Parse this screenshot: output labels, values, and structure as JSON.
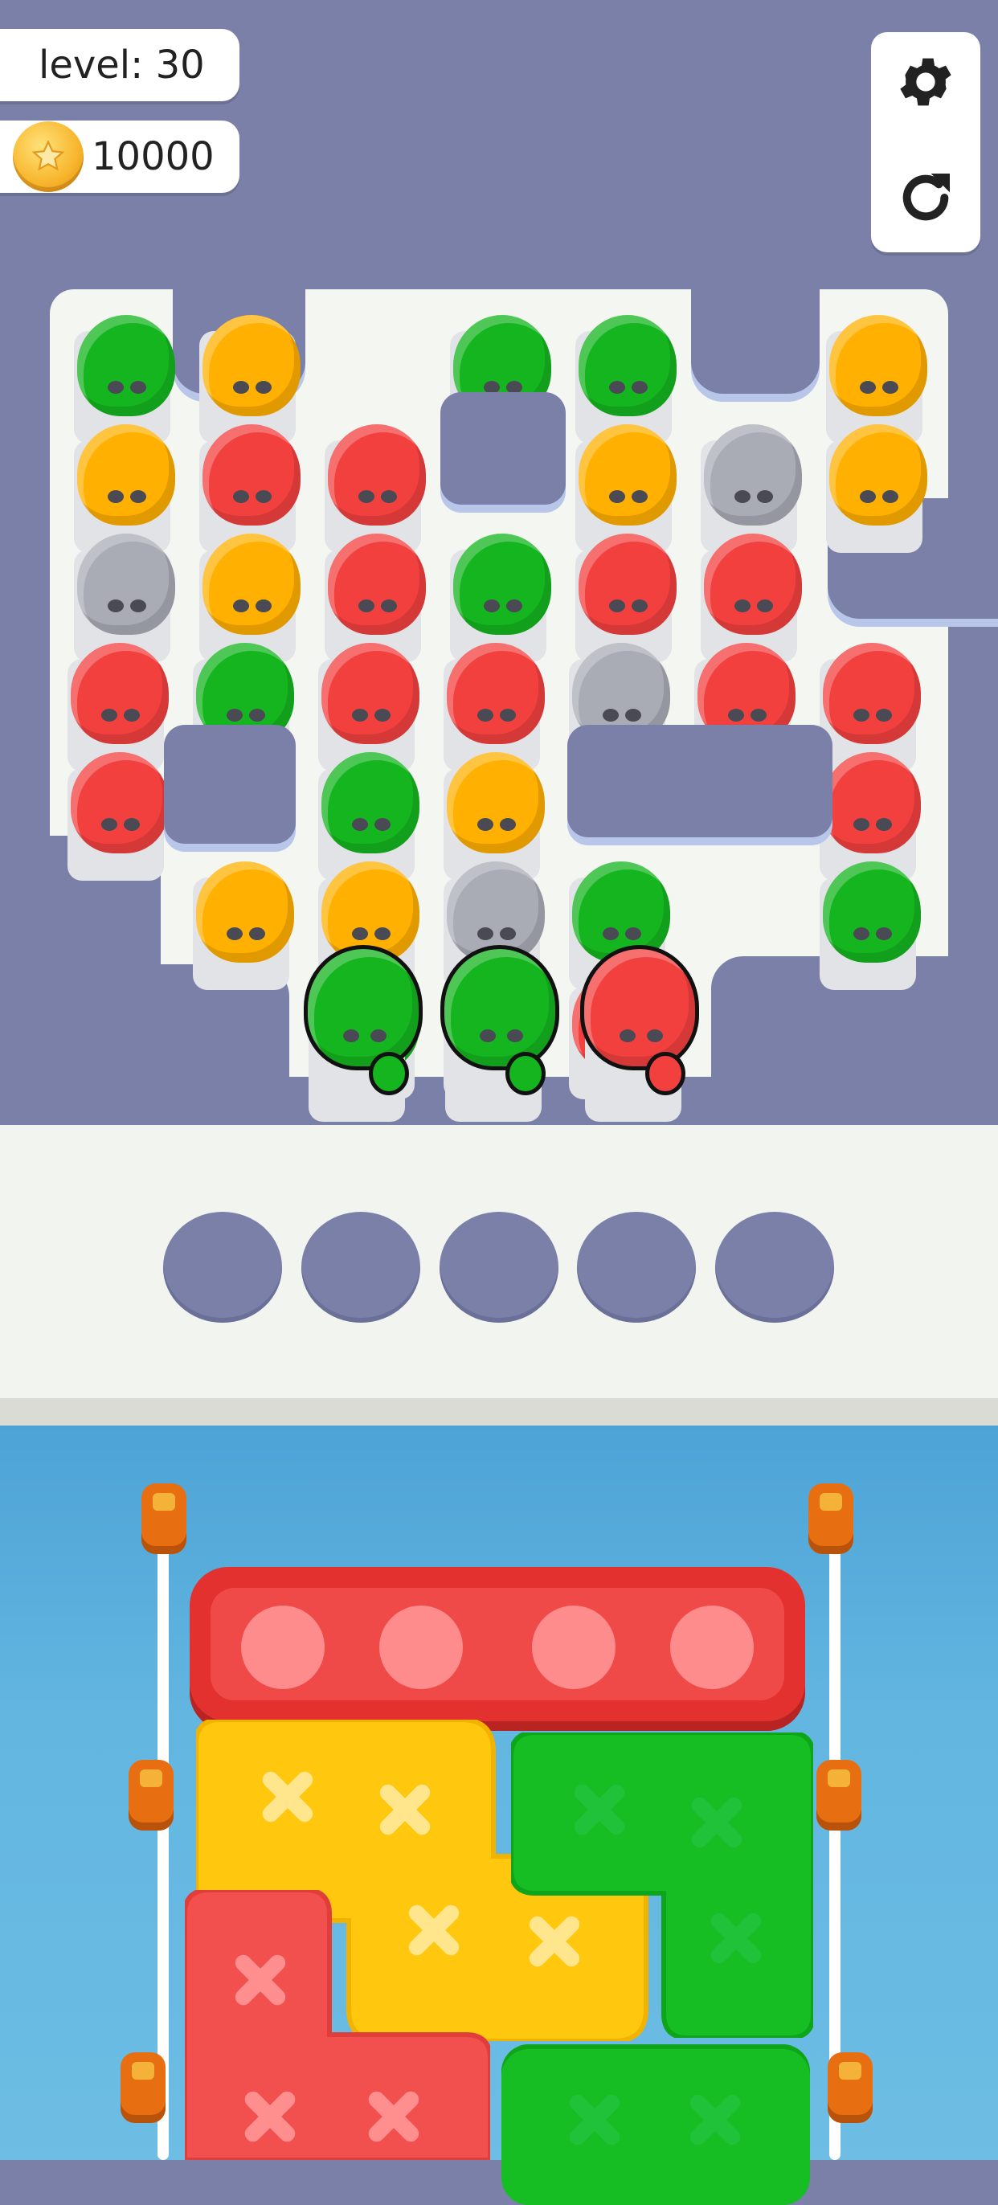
{
  "hud": {
    "level_label": "level: 30",
    "coins": "10000"
  },
  "icons": {
    "settings": "gear-icon",
    "restart": "restart-icon",
    "coin": "coin-icon"
  },
  "colors": {
    "green": "#15b51f",
    "orange": "#ffb000",
    "red": "#f2403f",
    "gray": "#a9acb5",
    "wall": "#7b80a8",
    "water": "#5fb3de"
  },
  "board": {
    "columns": 7,
    "grid": [
      [
        "green",
        "orange",
        "hole",
        "green",
        "green",
        "hole",
        "orange"
      ],
      [
        "orange",
        "red",
        "red",
        "hole",
        "orange",
        "gray",
        "orange"
      ],
      [
        "gray",
        "orange",
        "red",
        "green",
        "red",
        "red",
        "hole"
      ],
      [
        "red",
        "green",
        "red",
        "red",
        "gray",
        "red",
        "red"
      ],
      [
        "red",
        "hole",
        "green",
        "orange",
        "hole",
        "hole",
        "red"
      ],
      [
        "hole",
        "orange",
        "orange",
        "gray",
        "green",
        "hole",
        "green"
      ],
      [
        "hole",
        "hole",
        "green",
        "green",
        "red",
        "hole",
        "hole"
      ]
    ],
    "front_row_active": [
      "green",
      "green",
      "red"
    ]
  },
  "slots": {
    "count": 5,
    "filled": 0
  },
  "boats": [
    {
      "color": "red",
      "seats": 4,
      "type": "seated"
    },
    {
      "color": "yellow",
      "marks": 4
    },
    {
      "color": "green",
      "marks": 3
    },
    {
      "color": "red",
      "marks": 3
    },
    {
      "color": "green",
      "marks": 2
    }
  ]
}
